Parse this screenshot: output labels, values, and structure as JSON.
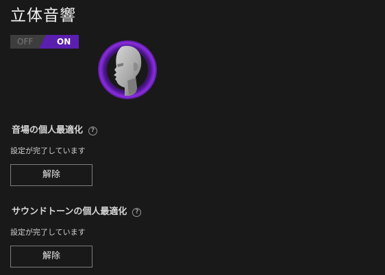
{
  "page": {
    "title": "立体音響"
  },
  "toggle": {
    "off_label": "OFF",
    "on_label": "ON",
    "state": "ON",
    "accent_color": "#5b1fb0"
  },
  "avatar": {
    "icon": "head-avatar-icon",
    "glow_color": "#7c2bd6"
  },
  "sections": [
    {
      "title": "音場の個人最適化",
      "help_icon": "question-circle-icon",
      "status": "設定が完了しています",
      "button_label": "解除"
    },
    {
      "title": "サウンドトーンの個人最適化",
      "help_icon": "question-circle-icon",
      "status": "設定が完了しています",
      "button_label": "解除"
    }
  ]
}
